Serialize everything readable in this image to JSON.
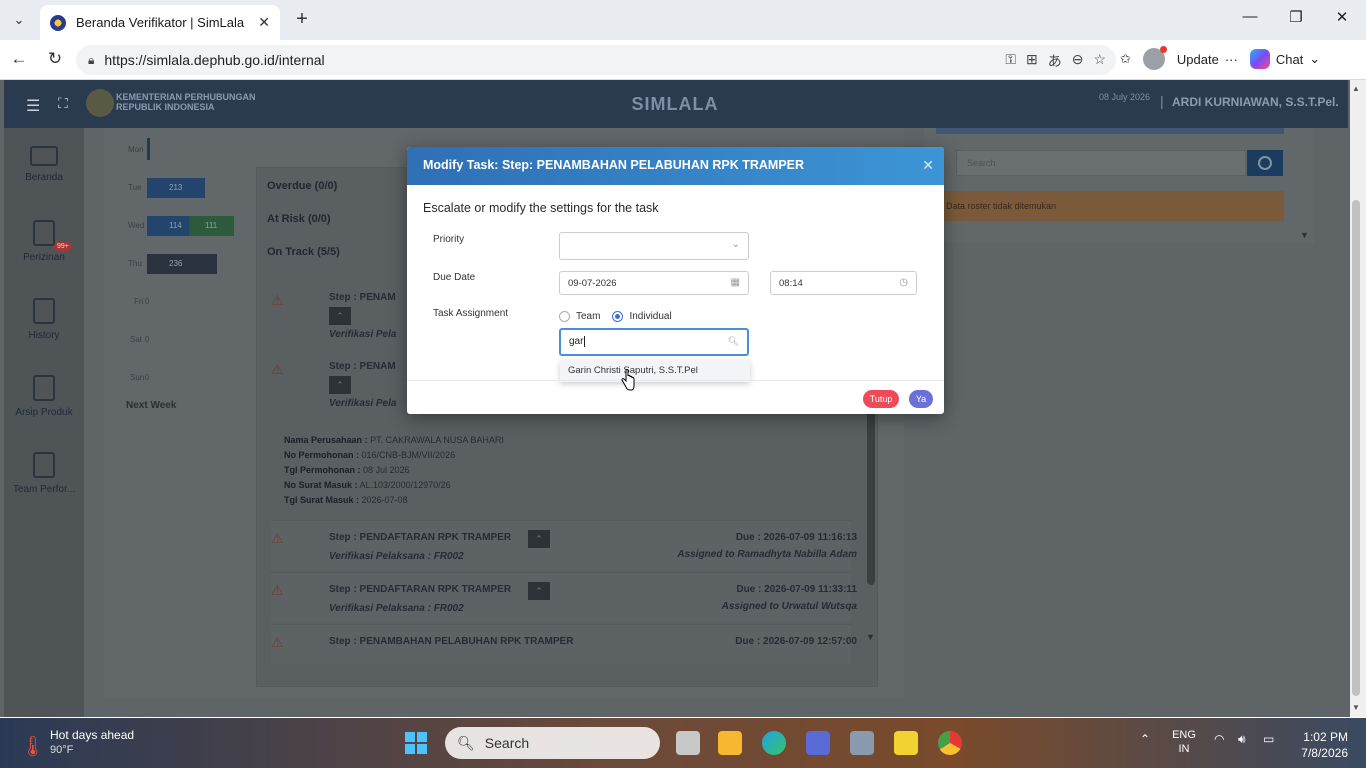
{
  "browser": {
    "tab_title": "Beranda Verifikator | SimLala",
    "url": "https://simlala.dephub.go.id/internal",
    "update_label": "Update",
    "chat_label": "Chat"
  },
  "app": {
    "ministry": "KEMENTERIAN PERHUBUNGAN REPUBLIK INDONESIA",
    "title": "SIMLALA",
    "date": "08 July 2026",
    "user": "ARDI KURNIAWAN, S.S.T.Pel."
  },
  "sidebar": {
    "items": [
      {
        "label": "Beranda"
      },
      {
        "label": "Perizinan",
        "badge": "99+"
      },
      {
        "label": "History"
      },
      {
        "label": "Arsip Produk"
      },
      {
        "label": "Team Perfor..."
      }
    ]
  },
  "calendar": {
    "days": [
      "Mon",
      "Tue",
      "Wed",
      "Thu",
      "Fri",
      "Sat",
      "Sun"
    ],
    "bars": [
      {
        "day": "Tue",
        "value": "213"
      },
      {
        "day": "Wed",
        "value": "114"
      },
      {
        "day": "Wed",
        "value": "111"
      },
      {
        "day": "Thu",
        "value": "236"
      }
    ],
    "zero_label": "0",
    "next_week": "Next Week"
  },
  "tasks_panel": {
    "overdue": "Overdue (0/0)",
    "at_risk": "At Risk (0/0)",
    "on_track": "On Track (5/5)",
    "card1_step": "Step : PENAM",
    "card1_sub": "Verifikasi Pela",
    "card2_step": "Step : PENAM",
    "card2_sub": "Verifikasi Pela",
    "info": {
      "company_label": "Nama Perusahaan :",
      "company": "PT. CAKRAWALA NUSA BAHARI",
      "app_no_label": "No Permohonan :",
      "app_no": "016/CNB-BJM/VII/2026",
      "app_date_label": "Tgl Permohonan :",
      "app_date": "08 Jul 2026",
      "letter_no_label": "No Surat Masuk :",
      "letter_no": "AL.103/2000/12970/26",
      "letter_date_label": "Tgl Surat Masuk :",
      "letter_date": "2026-07-08"
    },
    "card3_step": "Step : PENDAFTARAN RPK TRAMPER",
    "card3_sub": "Verifikasi Pelaksana : FR002",
    "card3_due": "Due : 2026-07-09 11:16:13",
    "card3_assigned": "Assigned to Ramadhyta Nabilla Adam",
    "card4_step": "Step : PENDAFTARAN RPK TRAMPER",
    "card4_sub": "Verifikasi Pelaksana : FR002",
    "card4_due": "Due : 2026-07-09 11:33:11",
    "card4_assigned": "Assigned to Urwatul Wutsqa",
    "card5_step": "Step : PENAMBAHAN PELABUHAN RPK TRAMPER",
    "card5_due": "Due : 2026-07-09 12:57:00"
  },
  "right_panel": {
    "search_placeholder": "Search",
    "alert": "Data roster tidak ditemukan"
  },
  "modal": {
    "title": "Modify Task: Step: PENAMBAHAN PELABUHAN RPK TRAMPER",
    "description": "Escalate or modify the settings for the task",
    "priority_label": "Priority",
    "priority_value": "",
    "due_date_label": "Due Date",
    "due_date_value": "09-07-2026",
    "due_time_value": "08:14",
    "assignment_label": "Task Assignment",
    "team_label": "Team",
    "individual_label": "Individual",
    "search_value": "gar",
    "suggestion": "Garin Christi Saputri, S.S.T.Pel",
    "close_label": "Tutup",
    "ok_label": "Ya"
  },
  "taskbar": {
    "weather_title": "Hot days ahead",
    "weather_temp": "90°F",
    "search_label": "Search",
    "lang_top": "ENG",
    "lang_bottom": "IN",
    "time": "1:02 PM",
    "date": "7/8/2026"
  }
}
